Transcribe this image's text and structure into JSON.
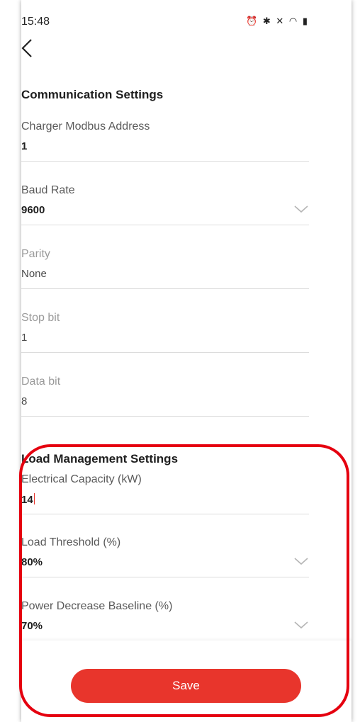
{
  "status_bar": {
    "time": "15:48",
    "icons": "⏰ ✱ ✕ ◠ ▮"
  },
  "communication": {
    "title": "Communication Settings",
    "fields": [
      {
        "label": "Charger Modbus Address",
        "value": "1"
      },
      {
        "label": "Baud Rate",
        "value": "9600"
      },
      {
        "label": "Parity",
        "value": "None"
      },
      {
        "label": "Stop bit",
        "value": "1"
      },
      {
        "label": "Data bit",
        "value": "8"
      }
    ]
  },
  "load_management": {
    "title": "Load Management Settings",
    "fields": [
      {
        "label": "Electrical Capacity (kW)",
        "value": "14"
      },
      {
        "label": "Load Threshold (%)",
        "value": "80%"
      },
      {
        "label": "Power Decrease Baseline (%)",
        "value": "70%"
      }
    ]
  },
  "footer": {
    "save_label": "Save"
  },
  "colors": {
    "accent": "#e8352c",
    "highlight": "#e5000f",
    "divider": "#dcdcdc"
  }
}
